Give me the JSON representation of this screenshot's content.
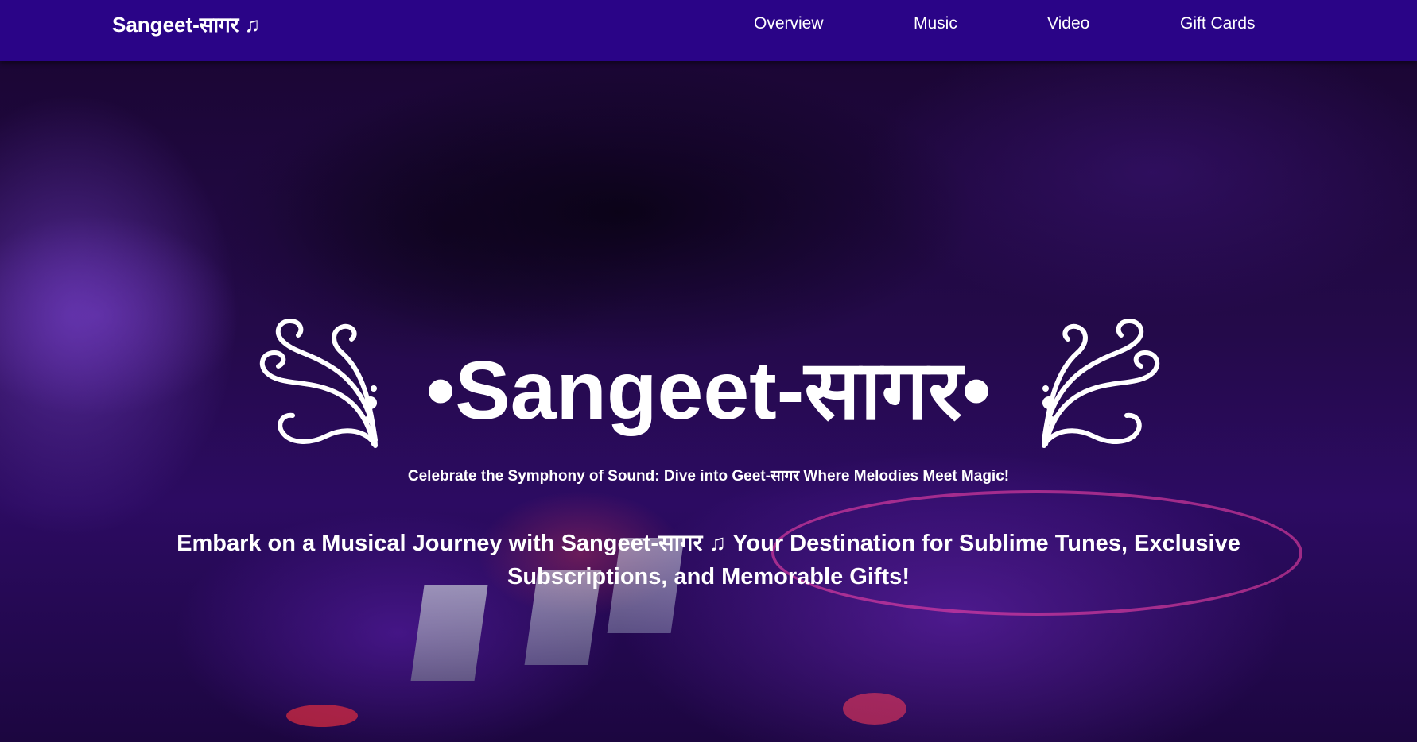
{
  "navbar": {
    "brand": "Sangeet-सागर ♫",
    "links": [
      "Overview",
      "Music",
      "Video",
      "Gift Cards"
    ]
  },
  "hero": {
    "title": "•Sangeet-सागर•",
    "tagline": "Celebrate the Symphony of Sound: Dive into Geet-सागर Where Melodies Meet Magic!",
    "intro": "Embark on a Musical Journey with Sangeet-सागर ♫ Your Destination for Sublime Tunes, Exclusive Subscriptions, and Memorable Gifts!"
  },
  "icons": [
    "music-note-icon",
    "flourish-left-icon",
    "flourish-right-icon"
  ],
  "colors": {
    "navbar_bg": "#2a0487",
    "text": "#ffffff",
    "hero_tint": "#2c0b62"
  }
}
